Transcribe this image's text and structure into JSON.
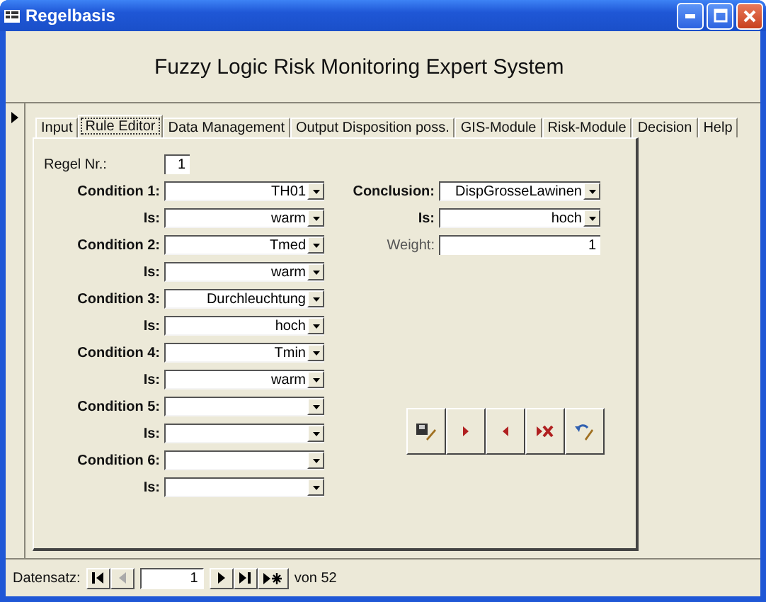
{
  "window": {
    "title": "Regelbasis"
  },
  "heading": "Fuzzy Logic Risk Monitoring Expert System",
  "tabs": [
    {
      "label": "Input",
      "selected": false
    },
    {
      "label": "Rule Editor",
      "selected": true
    },
    {
      "label": "Data Management",
      "selected": false
    },
    {
      "label": "Output Disposition poss.",
      "selected": false
    },
    {
      "label": "GIS-Module",
      "selected": false
    },
    {
      "label": "Risk-Module",
      "selected": false
    },
    {
      "label": "Decision",
      "selected": false
    },
    {
      "label": "Help",
      "selected": false
    }
  ],
  "rule_number": {
    "label": "Regel Nr.:",
    "value": "1"
  },
  "conditions": [
    {
      "label": "Condition 1:",
      "value": "TH01",
      "is_label": "Is:",
      "is_value": "warm"
    },
    {
      "label": "Condition 2:",
      "value": "Tmed",
      "is_label": "Is:",
      "is_value": "warm"
    },
    {
      "label": "Condition 3:",
      "value": "Durchleuchtung",
      "is_label": "Is:",
      "is_value": "hoch"
    },
    {
      "label": "Condition 4:",
      "value": "Tmin",
      "is_label": "Is:",
      "is_value": "warm"
    },
    {
      "label": "Condition 5:",
      "is_label": "Is:"
    },
    {
      "label": "Condition 6:",
      "is_label": "Is:"
    }
  ],
  "conclusion": {
    "label": "Conclusion:",
    "value": "DispGrosseLawinen",
    "is_label": "Is:",
    "is_value": "hoch",
    "weight_label": "Weight:",
    "weight": "1"
  },
  "action_buttons": [
    {
      "kind": "save"
    },
    {
      "kind": "next"
    },
    {
      "kind": "previous"
    },
    {
      "kind": "delete"
    },
    {
      "kind": "undo"
    }
  ],
  "navigation": {
    "label": "Datensatz:",
    "record": "1",
    "total": "von 52",
    "buttons": [
      {
        "kind": "first",
        "disabled": false
      },
      {
        "kind": "previous",
        "disabled": true
      },
      {
        "kind": "next",
        "disabled": false
      },
      {
        "kind": "last",
        "disabled": false
      },
      {
        "kind": "new",
        "disabled": false
      }
    ]
  }
}
